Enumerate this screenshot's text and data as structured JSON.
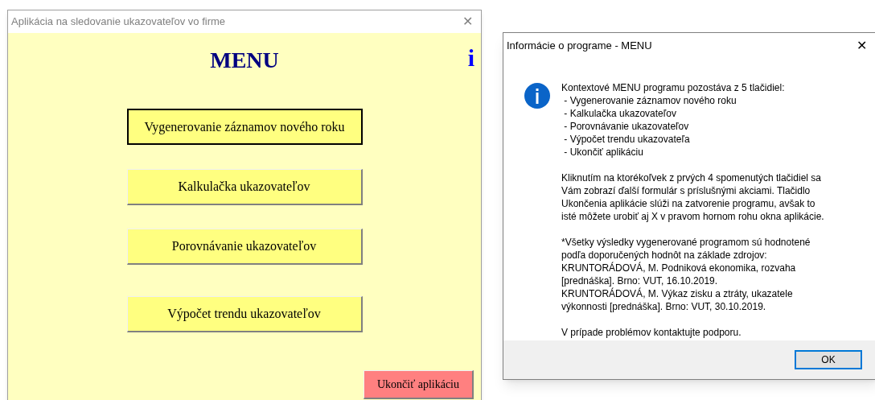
{
  "main_window": {
    "title": "Aplikácia na sledovanie ukazovateľov vo firme",
    "close": "✕",
    "heading": "MENU",
    "info": "i",
    "buttons": [
      {
        "label": "Vygenerovanie záznamov nového roku",
        "focused": true
      },
      {
        "label": "Kalkulačka ukazovateľov",
        "focused": false
      },
      {
        "label": "Porovnávanie ukazovateľov",
        "focused": false
      },
      {
        "label": "Výpočet trendu ukazovateľov",
        "focused": false
      }
    ],
    "exit_button": "Ukončiť aplikáciu"
  },
  "dialog": {
    "title": "Informácie o programe - MENU",
    "close": "✕",
    "paragraphs": [
      [
        "Kontextové MENU programu pozostáva z 5 tlačidiel:",
        " - Vygenerovanie záznamov nového roku",
        " - Kalkulačka ukazovateľov",
        " - Porovnávanie ukazovateľov",
        " - Výpočet trendu ukazovateľa",
        " - Ukončiť aplikáciu"
      ],
      [
        "Kliknutím na ktorékoľvek z prvých 4 spomenutých tlačidiel sa",
        "Vám zobrazí ďalší formulár s príslušnými akciami. Tlačidlo",
        "Ukončenia aplikácie slúži na zatvorenie programu, avšak to",
        "isté môžete urobiť aj X v pravom hornom rohu okna aplikácie."
      ],
      [
        "*Všetky výsledky vygenerované programom sú hodnotené",
        "podľa doporučených hodnôt na základe zdrojov:",
        "KRUNTORÁDOVÁ, M. Podniková ekonomika, rozvaha",
        "[prednáška]. Brno: VUT, 16.10.2019.",
        "KRUNTORÁDOVÁ, M. Výkaz zisku a ztráty, ukazatele",
        "výkonnosti [prednáška]. Brno: VUT, 30.10.2019."
      ],
      [
        "V prípade problémov kontaktujte podporu."
      ]
    ],
    "ok_button": "OK"
  }
}
